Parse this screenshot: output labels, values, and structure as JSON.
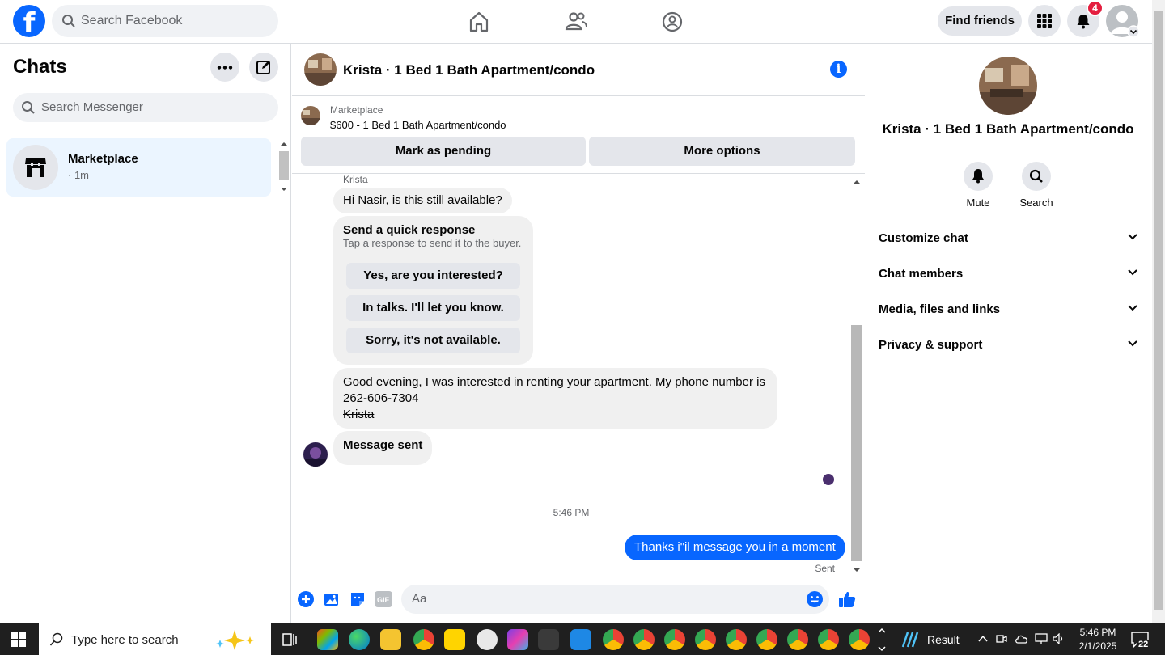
{
  "topbar": {
    "logo": "f",
    "search_placeholder": "Search Facebook",
    "find_friends": "Find friends",
    "notification_count": "4"
  },
  "chats": {
    "title": "Chats",
    "search_placeholder": "Search Messenger",
    "items": [
      {
        "name": "Marketplace",
        "time": "· 1m"
      }
    ]
  },
  "conversation": {
    "title": "Krista · 1 Bed 1 Bath Apartment/condo",
    "marketplace_label": "Marketplace",
    "listing": "$600 - 1 Bed 1 Bath Apartment/condo",
    "mark_pending": "Mark as pending",
    "more_options": "More options",
    "sender_name": "Krista",
    "messages": {
      "first": "Hi Nasir, is this still available?",
      "quick_title": "Send a quick response",
      "quick_sub": "Tap a response to send it to the buyer.",
      "quick_replies": [
        "Yes, are you interested?",
        "In talks. I'll let you know.",
        "Sorry, it's not available."
      ],
      "long_line1": "Good evening, I was interested in renting your apartment. My phone number is",
      "long_line2": "262-606-7304",
      "long_sign": "Krista",
      "sent_notice": "Message sent",
      "timestamp": "5:46 PM",
      "outgoing": "Thanks i\"il message you in a moment",
      "status": "Sent"
    },
    "composer_placeholder": "Aa"
  },
  "details": {
    "name": "Krista · 1 Bed 1 Bath Apartment/condo",
    "actions": [
      "Mute",
      "Search"
    ],
    "sections": [
      "Customize chat",
      "Chat members",
      "Media, files and links",
      "Privacy & support"
    ]
  },
  "taskbar": {
    "search_placeholder": "Type here to search",
    "weather": "Result",
    "time": "5:46 PM",
    "date": "2/1/2025",
    "notifications": "22"
  },
  "colors": {
    "brand": "#0866ff",
    "badge": "#e41e3f",
    "selected_chat": "#ebf5ff"
  }
}
